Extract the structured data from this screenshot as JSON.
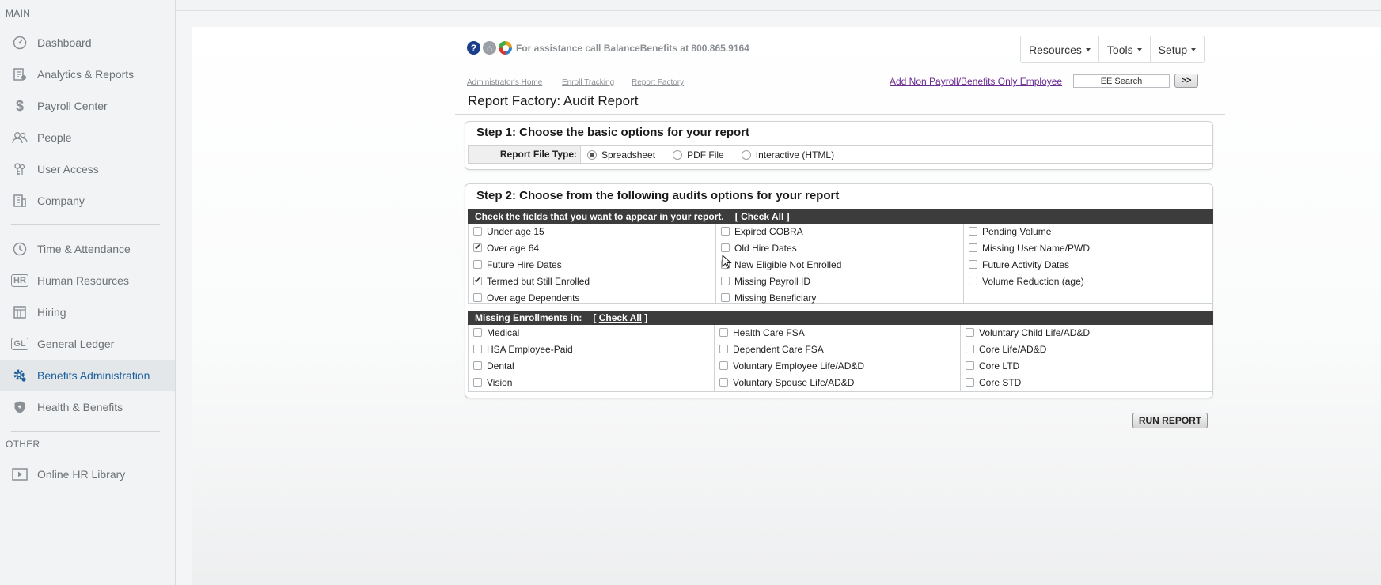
{
  "sidebar": {
    "main_label": "MAIN",
    "other_label": "OTHER",
    "items": [
      {
        "label": "Dashboard",
        "icon": "dashboard-icon"
      },
      {
        "label": "Analytics & Reports",
        "icon": "analytics-icon"
      },
      {
        "label": "Payroll Center",
        "icon": "dollar-icon"
      },
      {
        "label": "People",
        "icon": "people-icon"
      },
      {
        "label": "User Access",
        "icon": "keys-icon"
      },
      {
        "label": "Company",
        "icon": "building-icon"
      },
      {
        "label": "Time & Attendance",
        "icon": "clock-icon"
      },
      {
        "label": "Human Resources",
        "icon": "hr-icon",
        "icon_text": "HR"
      },
      {
        "label": "Hiring",
        "icon": "hiring-icon"
      },
      {
        "label": "General Ledger",
        "icon": "gl-icon",
        "icon_text": "GL"
      },
      {
        "label": "Benefits Administration",
        "icon": "gear-icon",
        "active": true
      },
      {
        "label": "Health & Benefits",
        "icon": "shield-icon"
      },
      {
        "label": "Online HR Library",
        "icon": "play-icon"
      }
    ]
  },
  "header": {
    "help_icons": [
      {
        "glyph": "?",
        "color": "#1a3e8c",
        "icon": "help-icon"
      },
      {
        "glyph": "⌂",
        "color": "#9aa0a6",
        "icon": "home-icon"
      },
      {
        "glyph": "",
        "color": "#e8a020",
        "icon": "lifering-icon"
      }
    ],
    "assist_text": "For assistance call BalanceBenefits at 800.865.9164",
    "menus": [
      "Resources",
      "Tools",
      "Setup"
    ]
  },
  "breadcrumbs": [
    "Administrator's Home",
    "Enroll Tracking",
    "Report Factory"
  ],
  "add_link": "Add Non Payroll/Benefits Only Employee",
  "ee_search": {
    "value": "EE Search",
    "go_label": ">>"
  },
  "page_title": "Report Factory: Audit Report",
  "step1": {
    "title": "Step 1: Choose the basic options for your report",
    "file_type_label": "Report File Type:",
    "options": [
      {
        "label": "Spreadsheet",
        "selected": true
      },
      {
        "label": "PDF File",
        "selected": false
      },
      {
        "label": "Interactive (HTML)",
        "selected": false
      }
    ]
  },
  "step2": {
    "title": "Step 2: Choose from the following audits options for your report",
    "fields_header": "Check the fields that you want to appear in your report.",
    "check_all": "Check All",
    "fields_columns": [
      [
        {
          "label": "Under age 15",
          "checked": false
        },
        {
          "label": "Over age 64",
          "checked": true
        },
        {
          "label": "Future Hire Dates",
          "checked": false
        },
        {
          "label": "Termed but Still Enrolled",
          "checked": true
        },
        {
          "label": "Over age Dependents",
          "checked": false
        }
      ],
      [
        {
          "label": "Expired COBRA",
          "checked": false
        },
        {
          "label": "Old Hire Dates",
          "checked": false
        },
        {
          "label": "New Eligible Not Enrolled",
          "checked": false
        },
        {
          "label": "Missing Payroll ID",
          "checked": false
        },
        {
          "label": "Missing Beneficiary",
          "checked": false
        }
      ],
      [
        {
          "label": "Pending Volume",
          "checked": false
        },
        {
          "label": "Missing User Name/PWD",
          "checked": false
        },
        {
          "label": "Future Activity Dates",
          "checked": false
        },
        {
          "label": "Volume Reduction (age)",
          "checked": false
        }
      ]
    ],
    "missing_header": "Missing Enrollments in:",
    "missing_columns": [
      [
        {
          "label": "Medical",
          "checked": false
        },
        {
          "label": "HSA Employee-Paid",
          "checked": false
        },
        {
          "label": "Dental",
          "checked": false
        },
        {
          "label": "Vision",
          "checked": false
        }
      ],
      [
        {
          "label": "Health Care FSA",
          "checked": false
        },
        {
          "label": "Dependent Care FSA",
          "checked": false
        },
        {
          "label": "Voluntary Employee Life/AD&D",
          "checked": false
        },
        {
          "label": "Voluntary Spouse Life/AD&D",
          "checked": false
        }
      ],
      [
        {
          "label": "Voluntary Child Life/AD&D",
          "checked": false
        },
        {
          "label": "Core Life/AD&D",
          "checked": false
        },
        {
          "label": "Core LTD",
          "checked": false
        },
        {
          "label": "Core STD",
          "checked": false
        }
      ]
    ]
  },
  "run_report_label": "RUN REPORT"
}
